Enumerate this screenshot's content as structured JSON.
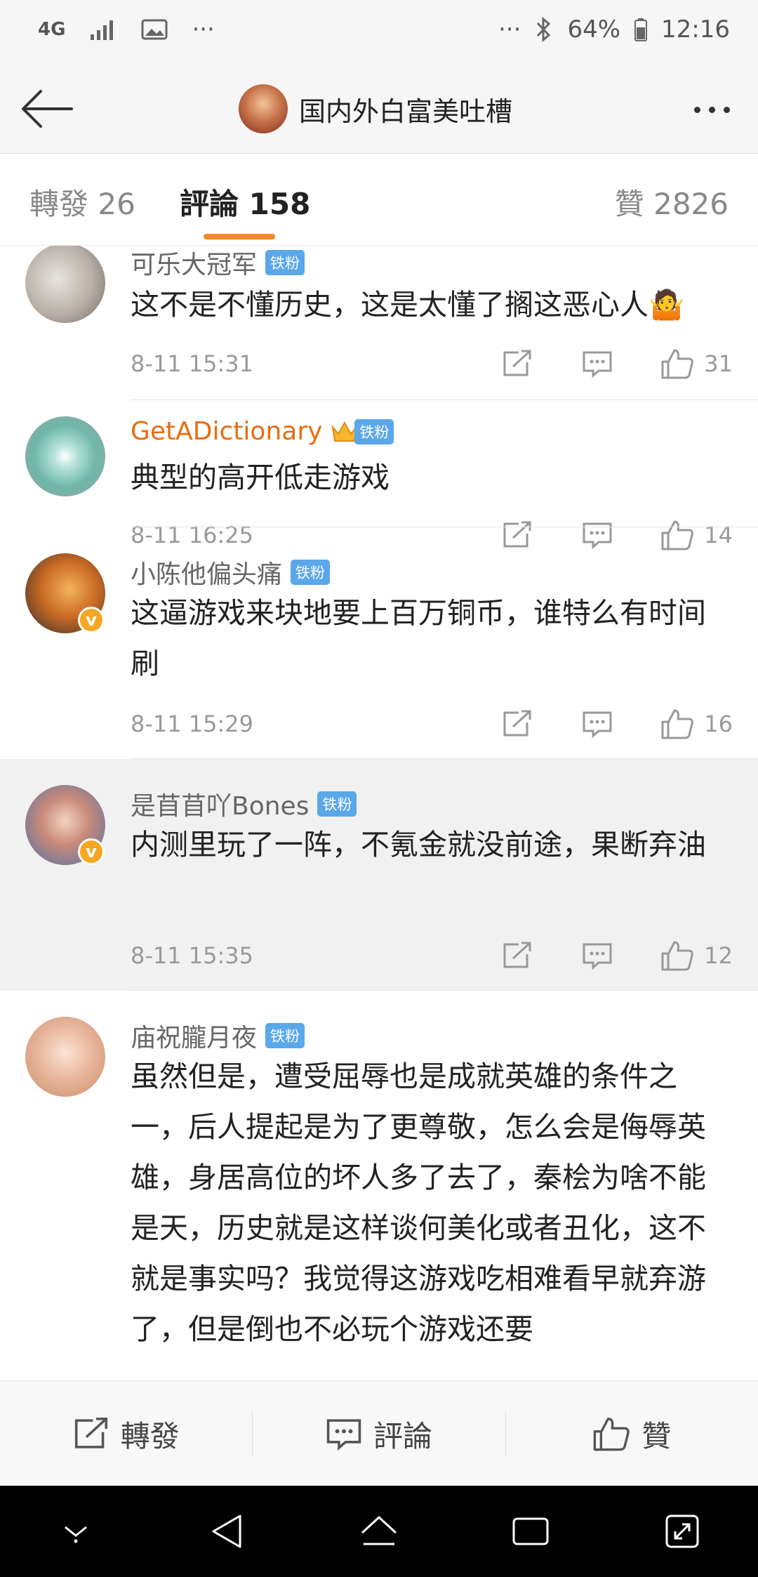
{
  "status_bar": {
    "network": "4G",
    "more": "···",
    "battery_percent": "64%",
    "time": "12:16"
  },
  "header": {
    "title": "国内外白富美吐槽"
  },
  "tabs": {
    "repost": "轉發 26",
    "comments": "評論 158",
    "likes": "贊 2826"
  },
  "comments": [
    {
      "username": "可乐大冠军",
      "badge": "铁粉",
      "text": "这不是不懂历史，这是太懂了搁这恶心人🤷",
      "time": "8-11 15:31",
      "likes": "31"
    },
    {
      "username": "GetADictionary",
      "badge": "铁粉",
      "text": "典型的高开低走游戏",
      "time": "8-11 16:25",
      "likes": "14"
    },
    {
      "username": "小陈他偏头痛",
      "badge": "铁粉",
      "text": "这逼游戏来块地要上百万铜币，谁特么有时间刷",
      "time": "8-11 15:29",
      "likes": "16"
    },
    {
      "username": "是苜苜吖Bones",
      "badge": "铁粉",
      "text": "内测里玩了一阵，不氪金就没前途，果断弃油",
      "time": "8-11 15:35",
      "likes": "12"
    },
    {
      "username": "庙祝朧月夜",
      "badge": "铁粉",
      "text": "虽然但是，遭受屈辱也是成就英雄的条件之一，后人提起是为了更尊敬，怎么会是侮辱英雄，身居高位的坏人多了去了，秦桧为啥不能是天，历史就是这样谈何美化或者丑化，这不就是事实吗？我觉得这游戏吃相难看早就弃游了，但是倒也不必玩个游戏还要"
    }
  ],
  "bottom_bar": {
    "repost": "轉發",
    "comment": "評論",
    "like": "贊"
  },
  "colors": {
    "accent_orange": "#f48a2a",
    "badge_blue": "#5aa7ea",
    "vip_name": "#e86c12"
  }
}
